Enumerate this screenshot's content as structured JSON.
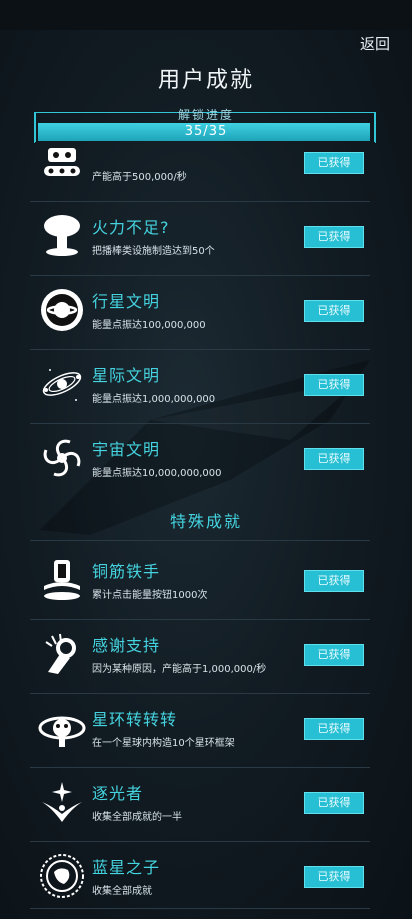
{
  "header": {
    "back": "返回",
    "title": "用户成就"
  },
  "progress": {
    "label": "解锁进度",
    "text": "35/35",
    "fraction": 1.0
  },
  "achievements": [
    {
      "name": "",
      "desc": "产能高于500,000/秒",
      "badge": "已获得",
      "icon": "robot-tank-icon"
    },
    {
      "name": "火力不足?",
      "desc": "把播棒类设施制造达到50个",
      "badge": "已获得",
      "icon": "mushroom-cloud-icon"
    },
    {
      "name": "行星文明",
      "desc": "能量点振达100,000,000",
      "badge": "已获得",
      "icon": "planet-icon"
    },
    {
      "name": "星际文明",
      "desc": "能量点振达1,000,000,000",
      "badge": "已获得",
      "icon": "galaxy-orbit-icon"
    },
    {
      "name": "宇宙文明",
      "desc": "能量点振达10,000,000,000",
      "badge": "已获得",
      "icon": "spiral-galaxy-icon"
    }
  ],
  "special_section": "特殊成就",
  "special": [
    {
      "name": "铜筋铁手",
      "desc": "累计点击能量按钮1000次",
      "badge": "已获得",
      "icon": "tap-button-icon"
    },
    {
      "name": "感谢支持",
      "desc": "因为某种原因，产能高于1,000,000/秒",
      "badge": "已获得",
      "icon": "ok-hand-icon"
    },
    {
      "name": "星环转转转",
      "desc": "在一个星球内构造10个星环框架",
      "badge": "已获得",
      "icon": "ring-station-icon"
    },
    {
      "name": "逐光者",
      "desc": "收集全部成就的一半",
      "badge": "已获得",
      "icon": "star-chaser-icon"
    },
    {
      "name": "蓝星之子",
      "desc": "收集全部成就",
      "badge": "已获得",
      "icon": "earth-medal-icon"
    }
  ]
}
